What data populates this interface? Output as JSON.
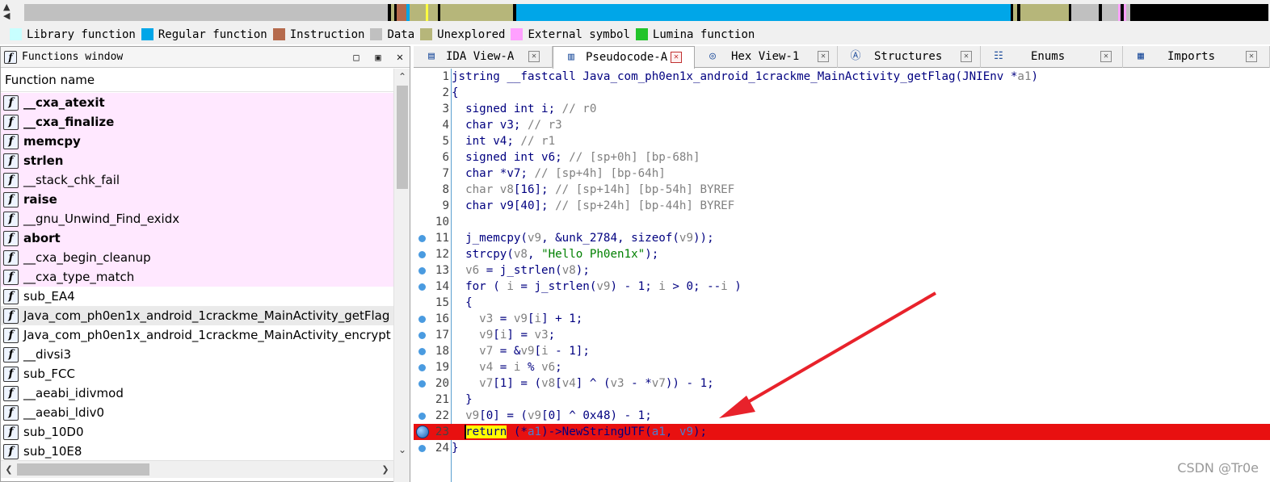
{
  "legend": [
    {
      "label": "Library function",
      "color": "#c8ffff"
    },
    {
      "label": "Regular function",
      "color": "#00a6e8"
    },
    {
      "label": "Instruction",
      "color": "#b56a4c"
    },
    {
      "label": "Data",
      "color": "#c0c0c0"
    },
    {
      "label": "Unexplored",
      "color": "#b6b67a"
    },
    {
      "label": "External symbol",
      "color": "#ffa0ff"
    },
    {
      "label": "Lumina function",
      "color": "#22c42a"
    }
  ],
  "functions_window": {
    "title": "Functions window",
    "column_header": "Function name",
    "items": [
      {
        "name": "__cxa_atexit",
        "kind": "lib-bold"
      },
      {
        "name": "__cxa_finalize",
        "kind": "lib-bold"
      },
      {
        "name": "memcpy",
        "kind": "lib-bold"
      },
      {
        "name": "strlen",
        "kind": "lib-bold"
      },
      {
        "name": "__stack_chk_fail",
        "kind": "lib"
      },
      {
        "name": "raise",
        "kind": "lib-bold"
      },
      {
        "name": "__gnu_Unwind_Find_exidx",
        "kind": "lib"
      },
      {
        "name": "abort",
        "kind": "lib-bold"
      },
      {
        "name": "__cxa_begin_cleanup",
        "kind": "lib"
      },
      {
        "name": "__cxa_type_match",
        "kind": "lib"
      },
      {
        "name": "sub_EA4",
        "kind": "regular"
      },
      {
        "name": "Java_com_ph0en1x_android_1crackme_MainActivity_getFlag",
        "kind": "selected"
      },
      {
        "name": "Java_com_ph0en1x_android_1crackme_MainActivity_encrypt",
        "kind": "regular"
      },
      {
        "name": "__divsi3",
        "kind": "regular"
      },
      {
        "name": "sub_FCC",
        "kind": "regular"
      },
      {
        "name": "__aeabi_idivmod",
        "kind": "regular"
      },
      {
        "name": "__aeabi_ldiv0",
        "kind": "regular"
      },
      {
        "name": "sub_10D0",
        "kind": "regular"
      },
      {
        "name": "sub_10E8",
        "kind": "regular"
      }
    ]
  },
  "tabs": [
    {
      "label": "IDA View-A",
      "icon": "ida-view-icon",
      "glyph": "▤",
      "active": false
    },
    {
      "label": "Pseudocode-A",
      "icon": "pseudocode-icon",
      "glyph": "▥",
      "active": true
    },
    {
      "label": "Hex View-1",
      "icon": "hex-view-icon",
      "glyph": "◎",
      "active": false
    },
    {
      "label": "Structures",
      "icon": "structures-icon",
      "glyph": "Ⓐ",
      "active": false
    },
    {
      "label": "Enums",
      "icon": "enums-icon",
      "glyph": "☷",
      "active": false
    },
    {
      "label": "Imports",
      "icon": "imports-icon",
      "glyph": "▦",
      "active": false
    }
  ],
  "code": {
    "highlight_line": 23,
    "lines": [
      {
        "n": "1",
        "bp": false,
        "tokens": [
          [
            "k",
            "jstring __fastcall Java_com_ph0en1x_android_1crackme_MainActivity_getFlag(JNIEnv *"
          ],
          [
            "v",
            "a1"
          ],
          [
            "k",
            ")"
          ]
        ]
      },
      {
        "n": "2",
        "bp": false,
        "tokens": [
          [
            "k",
            "{"
          ]
        ]
      },
      {
        "n": "3",
        "bp": false,
        "tokens": [
          [
            "k",
            "  signed int i; "
          ],
          [
            "c",
            "// r0"
          ]
        ]
      },
      {
        "n": "4",
        "bp": false,
        "tokens": [
          [
            "k",
            "  char v3; "
          ],
          [
            "c",
            "// r3"
          ]
        ]
      },
      {
        "n": "5",
        "bp": false,
        "tokens": [
          [
            "k",
            "  int v4; "
          ],
          [
            "c",
            "// r1"
          ]
        ]
      },
      {
        "n": "6",
        "bp": false,
        "tokens": [
          [
            "k",
            "  signed int v6; "
          ],
          [
            "c",
            "// [sp+0h] [bp-68h]"
          ]
        ]
      },
      {
        "n": "7",
        "bp": false,
        "tokens": [
          [
            "k",
            "  char *v7; "
          ],
          [
            "c",
            "// [sp+4h] [bp-64h]"
          ]
        ]
      },
      {
        "n": "8",
        "bp": false,
        "tokens": [
          [
            "c",
            "  char v8"
          ],
          [
            "k",
            "[16]; "
          ],
          [
            "c",
            "// [sp+14h] [bp-54h] BYREF"
          ]
        ]
      },
      {
        "n": "9",
        "bp": false,
        "tokens": [
          [
            "k",
            "  char v9[40]; "
          ],
          [
            "c",
            "// [sp+24h] [bp-44h] BYREF"
          ]
        ]
      },
      {
        "n": "10",
        "bp": false,
        "tokens": [
          [
            "k",
            ""
          ]
        ]
      },
      {
        "n": "11",
        "bp": true,
        "tokens": [
          [
            "k",
            "  j_memcpy("
          ],
          [
            "v",
            "v9"
          ],
          [
            "k",
            ", &unk_2784, sizeof("
          ],
          [
            "v",
            "v9"
          ],
          [
            "k",
            "));"
          ]
        ]
      },
      {
        "n": "12",
        "bp": true,
        "tokens": [
          [
            "k",
            "  strcpy("
          ],
          [
            "v",
            "v8"
          ],
          [
            "k",
            ", "
          ],
          [
            "s",
            "\"Hello Ph0en1x\""
          ],
          [
            "k",
            ");"
          ]
        ]
      },
      {
        "n": "13",
        "bp": true,
        "tokens": [
          [
            "k",
            "  "
          ],
          [
            "v",
            "v6"
          ],
          [
            "k",
            " = j_strlen("
          ],
          [
            "v",
            "v8"
          ],
          [
            "k",
            ");"
          ]
        ]
      },
      {
        "n": "14",
        "bp": true,
        "tokens": [
          [
            "k",
            "  for ( "
          ],
          [
            "v",
            "i"
          ],
          [
            "k",
            " = j_strlen("
          ],
          [
            "v",
            "v9"
          ],
          [
            "k",
            ") - 1; "
          ],
          [
            "v",
            "i"
          ],
          [
            "k",
            " > 0; --"
          ],
          [
            "v",
            "i"
          ],
          [
            "k",
            " )"
          ]
        ]
      },
      {
        "n": "15",
        "bp": false,
        "tokens": [
          [
            "k",
            "  {"
          ]
        ]
      },
      {
        "n": "16",
        "bp": true,
        "tokens": [
          [
            "k",
            "    "
          ],
          [
            "v",
            "v3"
          ],
          [
            "k",
            " = "
          ],
          [
            "v",
            "v9"
          ],
          [
            "k",
            "["
          ],
          [
            "v",
            "i"
          ],
          [
            "k",
            "] + 1;"
          ]
        ]
      },
      {
        "n": "17",
        "bp": true,
        "tokens": [
          [
            "k",
            "    "
          ],
          [
            "v",
            "v9"
          ],
          [
            "k",
            "["
          ],
          [
            "v",
            "i"
          ],
          [
            "k",
            "] = "
          ],
          [
            "v",
            "v3"
          ],
          [
            "k",
            ";"
          ]
        ]
      },
      {
        "n": "18",
        "bp": true,
        "tokens": [
          [
            "k",
            "    "
          ],
          [
            "v",
            "v7"
          ],
          [
            "k",
            " = &"
          ],
          [
            "v",
            "v9"
          ],
          [
            "k",
            "["
          ],
          [
            "v",
            "i"
          ],
          [
            "k",
            " - 1];"
          ]
        ]
      },
      {
        "n": "19",
        "bp": true,
        "tokens": [
          [
            "k",
            "    "
          ],
          [
            "v",
            "v4"
          ],
          [
            "k",
            " = "
          ],
          [
            "v",
            "i"
          ],
          [
            "k",
            " % "
          ],
          [
            "v",
            "v6"
          ],
          [
            "k",
            ";"
          ]
        ]
      },
      {
        "n": "20",
        "bp": true,
        "tokens": [
          [
            "k",
            "    "
          ],
          [
            "v",
            "v7"
          ],
          [
            "k",
            "[1] = ("
          ],
          [
            "v",
            "v8"
          ],
          [
            "k",
            "["
          ],
          [
            "v",
            "v4"
          ],
          [
            "k",
            "] ^ ("
          ],
          [
            "v",
            "v3"
          ],
          [
            "k",
            " - *"
          ],
          [
            "v",
            "v7"
          ],
          [
            "k",
            ")) - 1;"
          ]
        ]
      },
      {
        "n": "21",
        "bp": false,
        "tokens": [
          [
            "k",
            "  }"
          ]
        ]
      },
      {
        "n": "22",
        "bp": true,
        "tokens": [
          [
            "k",
            "  "
          ],
          [
            "v",
            "v9"
          ],
          [
            "k",
            "[0] = ("
          ],
          [
            "v",
            "v9"
          ],
          [
            "k",
            "[0] ^ 0x48) - 1;"
          ]
        ]
      },
      {
        "n": "23",
        "bp": true,
        "tokens": [
          [
            "k",
            "  "
          ],
          [
            "ret",
            "return"
          ],
          [
            "k",
            " (*"
          ],
          [
            "rv",
            "a1"
          ],
          [
            "k",
            ")->NewStringUTF("
          ],
          [
            "rv",
            "a1"
          ],
          [
            "k",
            ", "
          ],
          [
            "rv",
            "v9"
          ],
          [
            "k",
            ");"
          ]
        ]
      },
      {
        "n": "24",
        "bp": true,
        "tokens": [
          [
            "k",
            "}"
          ]
        ]
      }
    ]
  },
  "watermark": "CSDN @Tr0e"
}
